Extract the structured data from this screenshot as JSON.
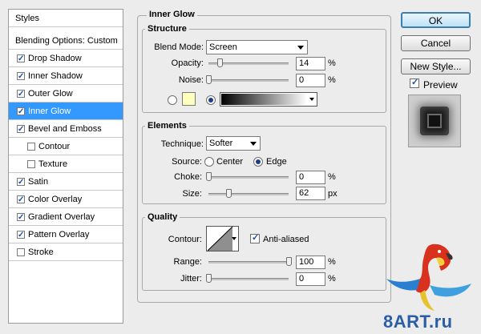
{
  "styles_panel": {
    "header_styles": "Styles",
    "header_blending": "Blending Options: Custom",
    "items": [
      {
        "label": "Drop Shadow",
        "checked": true
      },
      {
        "label": "Inner Shadow",
        "checked": true
      },
      {
        "label": "Outer Glow",
        "checked": true
      },
      {
        "label": "Inner Glow",
        "checked": true,
        "selected": true
      },
      {
        "label": "Bevel and Emboss",
        "checked": true
      },
      {
        "label": "Contour",
        "checked": false
      },
      {
        "label": "Texture",
        "checked": false
      },
      {
        "label": "Satin",
        "checked": true
      },
      {
        "label": "Color Overlay",
        "checked": true
      },
      {
        "label": "Gradient Overlay",
        "checked": true
      },
      {
        "label": "Pattern Overlay",
        "checked": true
      },
      {
        "label": "Stroke",
        "checked": false
      }
    ]
  },
  "inner_glow": {
    "title": "Inner Glow",
    "structure": {
      "title": "Structure",
      "blend_mode_label": "Blend Mode:",
      "blend_mode_value": "Screen",
      "opacity_label": "Opacity:",
      "opacity_value": "14",
      "opacity_unit": "%",
      "opacity_level": 0.14,
      "noise_label": "Noise:",
      "noise_value": "0",
      "noise_unit": "%",
      "noise_level": 0.0,
      "swatch_color": "#ffffbe",
      "gradient_selected": true
    },
    "elements": {
      "title": "Elements",
      "technique_label": "Technique:",
      "technique_value": "Softer",
      "source_label": "Source:",
      "source_center": "Center",
      "source_edge": "Edge",
      "source_selected": "Edge",
      "choke_label": "Choke:",
      "choke_value": "0",
      "choke_unit": "%",
      "choke_level": 0.0,
      "size_label": "Size:",
      "size_value": "62",
      "size_unit": "px",
      "size_level": 0.25
    },
    "quality": {
      "title": "Quality",
      "contour_label": "Contour:",
      "anti_aliased_label": "Anti-aliased",
      "anti_aliased_checked": true,
      "range_label": "Range:",
      "range_value": "100",
      "range_unit": "%",
      "range_level": 1.0,
      "jitter_label": "Jitter:",
      "jitter_value": "0",
      "jitter_unit": "%",
      "jitter_level": 0.0
    }
  },
  "buttons": {
    "ok": "OK",
    "cancel": "Cancel",
    "new_style": "New Style...",
    "preview_label": "Preview",
    "preview_checked": true
  },
  "watermark": "8ART.ru",
  "colors": {
    "selection": "#3399ff",
    "ok_border": "#3c7fb1"
  }
}
